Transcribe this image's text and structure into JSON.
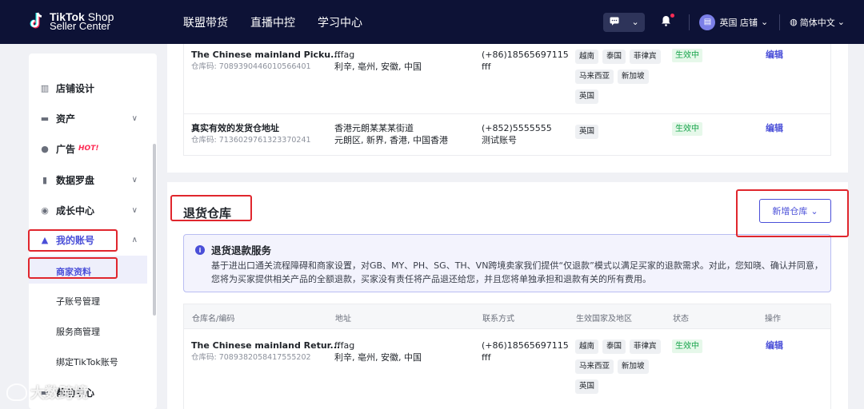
{
  "brand": {
    "line1_bold": "TikTok",
    "line1_rest": " Shop",
    "line2": "Seller Center"
  },
  "topnav": {
    "items": [
      "联盟带货",
      "直播中控",
      "学习中心"
    ]
  },
  "header": {
    "store": "英国 店铺",
    "language": "简体中文"
  },
  "sidebar": {
    "items": [
      {
        "label": "店铺设计",
        "icon": "store-icon"
      },
      {
        "label": "资产",
        "icon": "wallet-icon"
      },
      {
        "label": "广告",
        "icon": "ads-icon",
        "badge": "HOT!"
      },
      {
        "label": "数据罗盘",
        "icon": "chart-icon"
      },
      {
        "label": "成长中心",
        "icon": "medal-icon"
      },
      {
        "label": "我的账号",
        "icon": "user-icon"
      }
    ],
    "sub_items": [
      "商家资料",
      "子账号管理",
      "服务商管理",
      "绑定TikTok账号"
    ],
    "partial_item": "帮助中心"
  },
  "top_table": {
    "rows": [
      {
        "name": "The Chinese mainland Picku...",
        "code": "仓库码: 7089390446010566401",
        "addr1": "fffag",
        "addr2": "利辛, 亳州, 安徽, 中国",
        "contact1": "(+86)18565697115",
        "contact2": "fff",
        "regions": [
          "越南",
          "泰国",
          "菲律宾",
          "马来西亚",
          "新加坡",
          "英国"
        ],
        "status": "生效中",
        "action": "编辑"
      },
      {
        "name": "真实有效的发货仓地址",
        "code": "仓库码: 7136029761323370241",
        "addr1": "香港元朗某某某街道",
        "addr2": "元朗区, 新界, 香港, 中国香港",
        "contact1": "(+852)5555555",
        "contact2": "测试账号",
        "regions": [
          "英国"
        ],
        "status": "生效中",
        "action": "编辑"
      }
    ]
  },
  "return_section": {
    "title": "退货仓库",
    "add_button": "新增仓库",
    "notice_title": "退货退款服务",
    "notice_body": "基于进出口通关流程障碍和商家设置，对GB、MY、PH、SG、TH、VN跨境卖家我们提供“仅退款”模式以满足买家的退款需求。对此，您知晓、确认并同意，您将为买家提供相关产品的全额退款，买家没有责任将产品退还给您，并且您将单独承担和退款有关的所有费用。",
    "headers": [
      "仓库名/编码",
      "地址",
      "联系方式",
      "生效国家及地区",
      "状态",
      "操作"
    ],
    "rows": [
      {
        "name": "The Chinese mainland Retur...",
        "code": "仓库码: 7089382058417555202",
        "addr1": "fffag",
        "addr2": "利辛, 亳州, 安徽, 中国",
        "contact1": "(+86)18565697115",
        "contact2": "fff",
        "regions": [
          "越南",
          "泰国",
          "菲律宾",
          "马来西亚",
          "新加坡",
          "英国"
        ],
        "status": "生效中",
        "action": "编辑"
      }
    ]
  },
  "watermark": "大数跨境",
  "colors": {
    "nav_bg": "#0d1236",
    "accent": "#4a4fd8",
    "highlight": "#e0262d",
    "status_green": "#16a34a",
    "hot": "#fe2c55"
  }
}
